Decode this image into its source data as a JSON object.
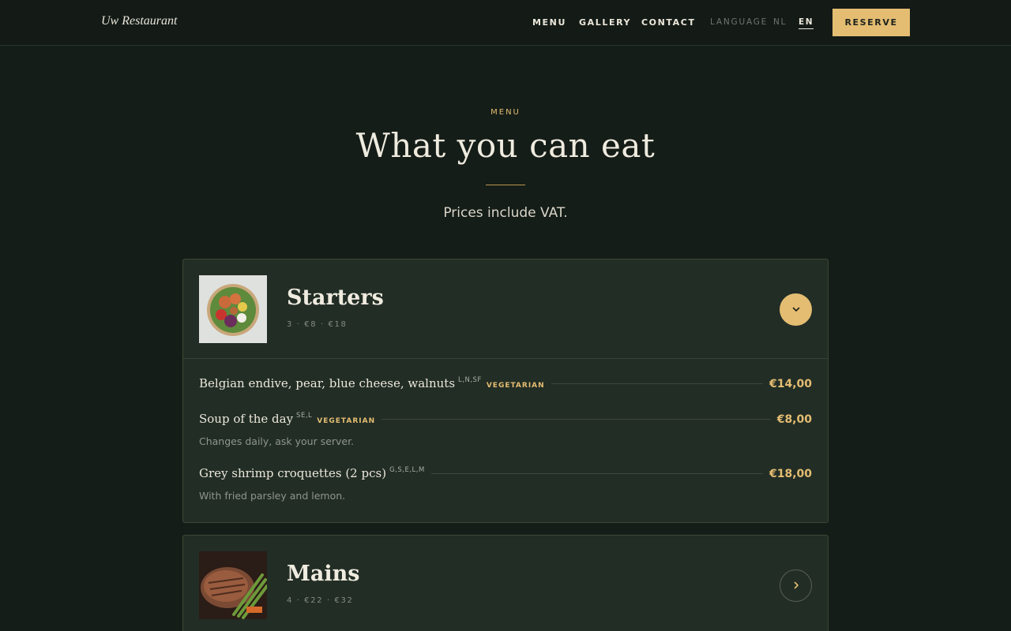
{
  "brand": "Uw Restaurant",
  "nav": {
    "menu": "MENU",
    "gallery": "GALLERY",
    "contact": "CONTACT"
  },
  "language": {
    "label": "LANGUAGE",
    "nl": "NL",
    "en": "EN",
    "active": "EN"
  },
  "reserve_label": "RESERVE",
  "hero": {
    "eyebrow": "MENU",
    "title": "What you can eat",
    "subtitle": "Prices include VAT."
  },
  "categories": [
    {
      "name": "Starters",
      "meta": "3 · €8 · €18",
      "expanded": true,
      "items": [
        {
          "name": "Belgian endive, pear, blue cheese, walnuts",
          "allergens": "L,N,SF",
          "tag": "VEGETARIAN",
          "price": "€14,00",
          "description": ""
        },
        {
          "name": "Soup of the day",
          "allergens": "SE,L",
          "tag": "VEGETARIAN",
          "price": "€8,00",
          "description": "Changes daily, ask your server."
        },
        {
          "name": "Grey shrimp croquettes (2 pcs)",
          "allergens": "G,S,E,L,M",
          "tag": "",
          "price": "€18,00",
          "description": "With fried parsley and lemon."
        }
      ]
    },
    {
      "name": "Mains",
      "meta": "4 · €22 · €32",
      "expanded": false,
      "items": []
    }
  ],
  "icons": {
    "expanded": "chevron-down-icon",
    "collapsed": "chevron-right-icon"
  },
  "colors": {
    "accent": "#e4bd72",
    "background": "#151d18",
    "card": "#222d25"
  }
}
